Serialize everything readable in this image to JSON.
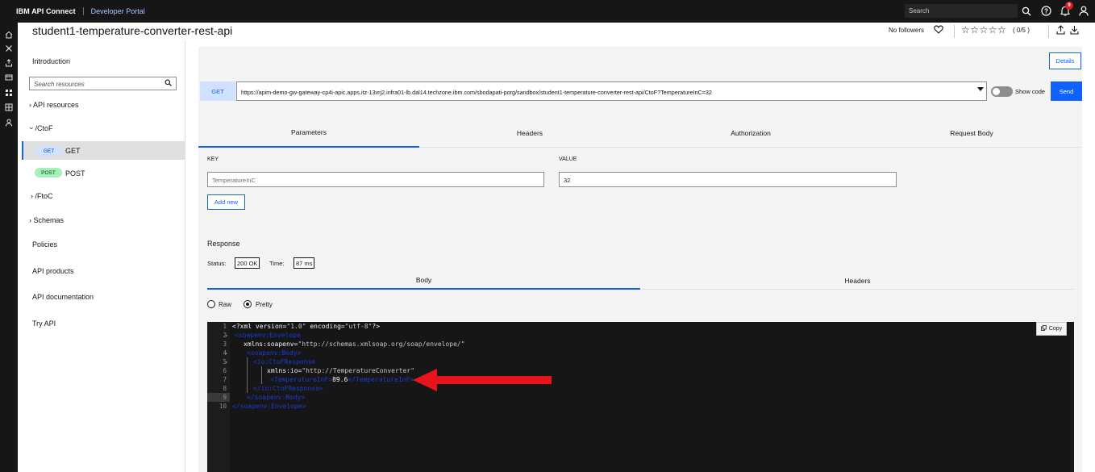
{
  "header": {
    "brand": "IBM API Connect",
    "portal": "Developer Portal",
    "search_placeholder": "Search",
    "notification_count": "9"
  },
  "api": {
    "title": "student1-temperature-converter-rest-api",
    "followers": "No followers",
    "stars": "☆☆☆☆☆",
    "rating": "( 0/5 )"
  },
  "sidebar": {
    "introduction": "Introduction",
    "search_placeholder": "Search resources",
    "api_resources": "API resources",
    "ctof_path": "/CtoF",
    "get_method": "GET",
    "get_label": "GET",
    "post_method": "POST",
    "post_label": "POST",
    "ftoc_path": "/FtoC",
    "schemas": "Schemas",
    "policies": "Policies",
    "api_products": "API products",
    "api_documentation": "API documentation",
    "try_api": "Try API"
  },
  "request": {
    "details_label": "Details",
    "method": "GET",
    "url": "https://apim-demo-gw-gateway-cp4i-apic.apps.itz-13vrj2.infra01-lb.dal14.techzone.ibm.com/sbodapati-porg/sandbox/student1-temperature-converter-rest-api/CtoF?TemperatureInC=32",
    "show_code_label": "Show code",
    "send_label": "Send",
    "tabs": [
      "Parameters",
      "Headers",
      "Authorization",
      "Request Body"
    ],
    "key_header": "KEY",
    "value_header": "VALUE",
    "param_key": "TemperatureInC",
    "param_value": "32",
    "add_new_label": "Add new"
  },
  "response": {
    "title": "Response",
    "status_label": "Status:",
    "status_value": "200 OK",
    "time_label": "Time:",
    "time_value": "87 ms",
    "tabs": [
      "Body",
      "Headers"
    ],
    "raw_label": "Raw",
    "pretty_label": "Pretty",
    "copy_label": "Copy",
    "line_numbers": [
      "1",
      "2",
      "3",
      "4",
      "5",
      "6",
      "7",
      "8",
      "9",
      "10"
    ],
    "code": {
      "l1_a": "<?xml version=",
      "l1_b": "\"1.0\"",
      "l1_c": " encoding=",
      "l1_d": "\"utf-8\"",
      "l1_e": "?>",
      "l2": "<soapenv:Envelope",
      "l3_a": "xmlns:soapenv=",
      "l3_b": "\"http://schemas.xmlsoap.org/soap/envelope/\"",
      "l4": "<soapenv:Body>",
      "l5": "<io:CtoFResponse",
      "l6_a": "xmlns:io=",
      "l6_b": "\"http://TemperatureConverter\"",
      "l7_open": "<TemperatureInF>",
      "l7_value": "89.6",
      "l7_close": "</TemperatureInF>",
      "l8": "</io:CtoFResponse>",
      "l9": "</soapenv:Body>",
      "l10": "</soapenv:Envelope>"
    }
  },
  "colors": {
    "accent": "#0f62fe",
    "arrow": "#e8141c",
    "header_bg": "#161616"
  }
}
